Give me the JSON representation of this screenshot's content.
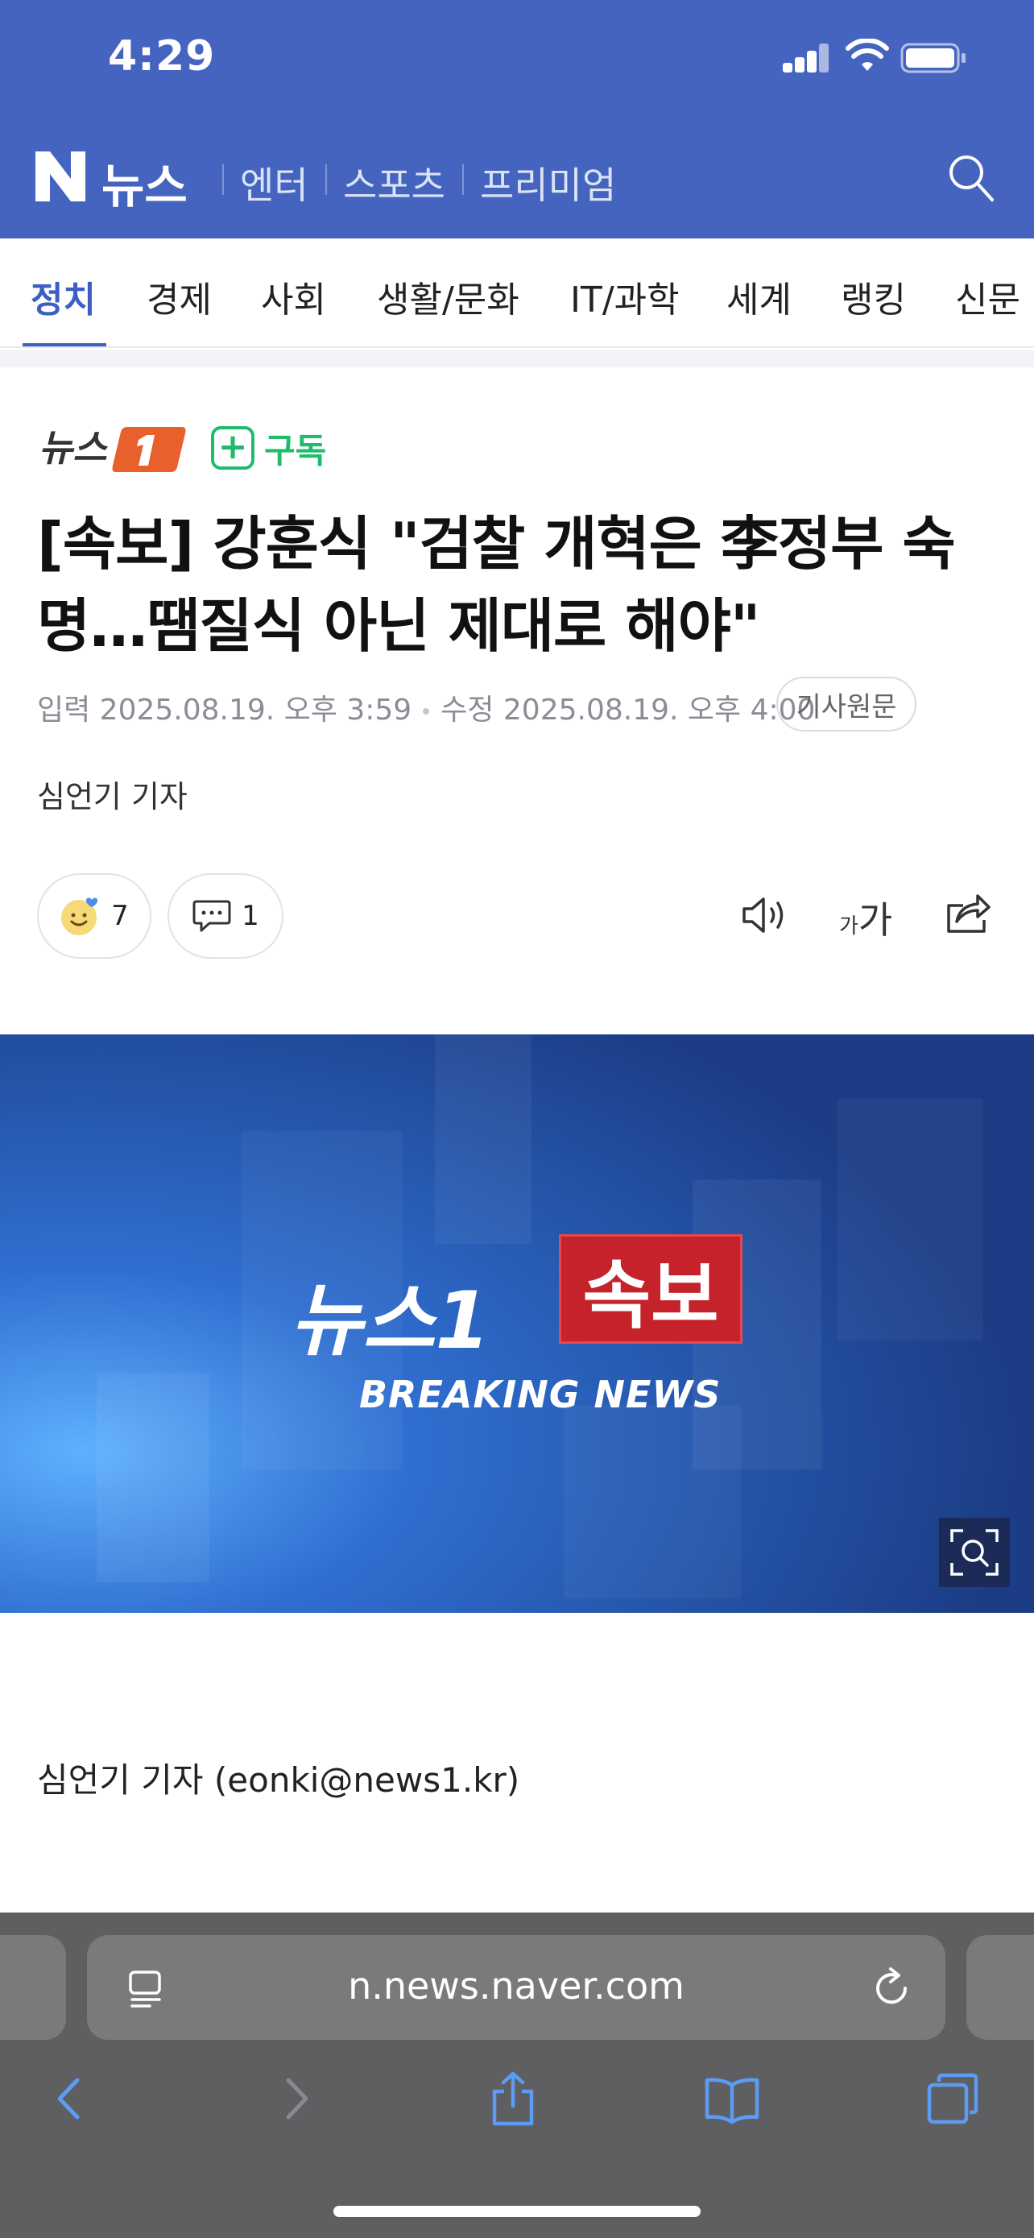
{
  "status_bar": {
    "time": "4:29"
  },
  "header": {
    "brand_text": "뉴스",
    "nav": [
      "엔터",
      "스포츠",
      "프리미엄"
    ]
  },
  "tabs": [
    "정치",
    "경제",
    "사회",
    "생활/문화",
    "IT/과학",
    "세계",
    "랭킹",
    "신문"
  ],
  "active_tab": "정치",
  "article": {
    "subscribe_label": "구독",
    "headline": "[속보] 강훈식 \"검찰 개혁은 李정부 숙명…땜질식 아닌 제대로 해야\"",
    "meta_input": "입력 2025.08.19. 오후 3:59",
    "meta_edit": "수정 2025.08.19. 오후 4:00",
    "original_button": "기사원문",
    "reporter": "심언기 기자",
    "reaction_count": "7",
    "comment_count": "1",
    "font_size_label_small": "가",
    "font_size_label_large": "가",
    "byline": "심언기 기자 (eonki@news1.kr)"
  },
  "photo": {
    "brand": "뉴스1",
    "badge": "속보",
    "caption": "BREAKING NEWS"
  },
  "browser": {
    "url": "n.news.naver.com"
  },
  "colors": {
    "header": "#4564bf",
    "accent": "#3d5fc4",
    "subscribe": "#1fbc6c",
    "press_logo": "#e8602c"
  }
}
